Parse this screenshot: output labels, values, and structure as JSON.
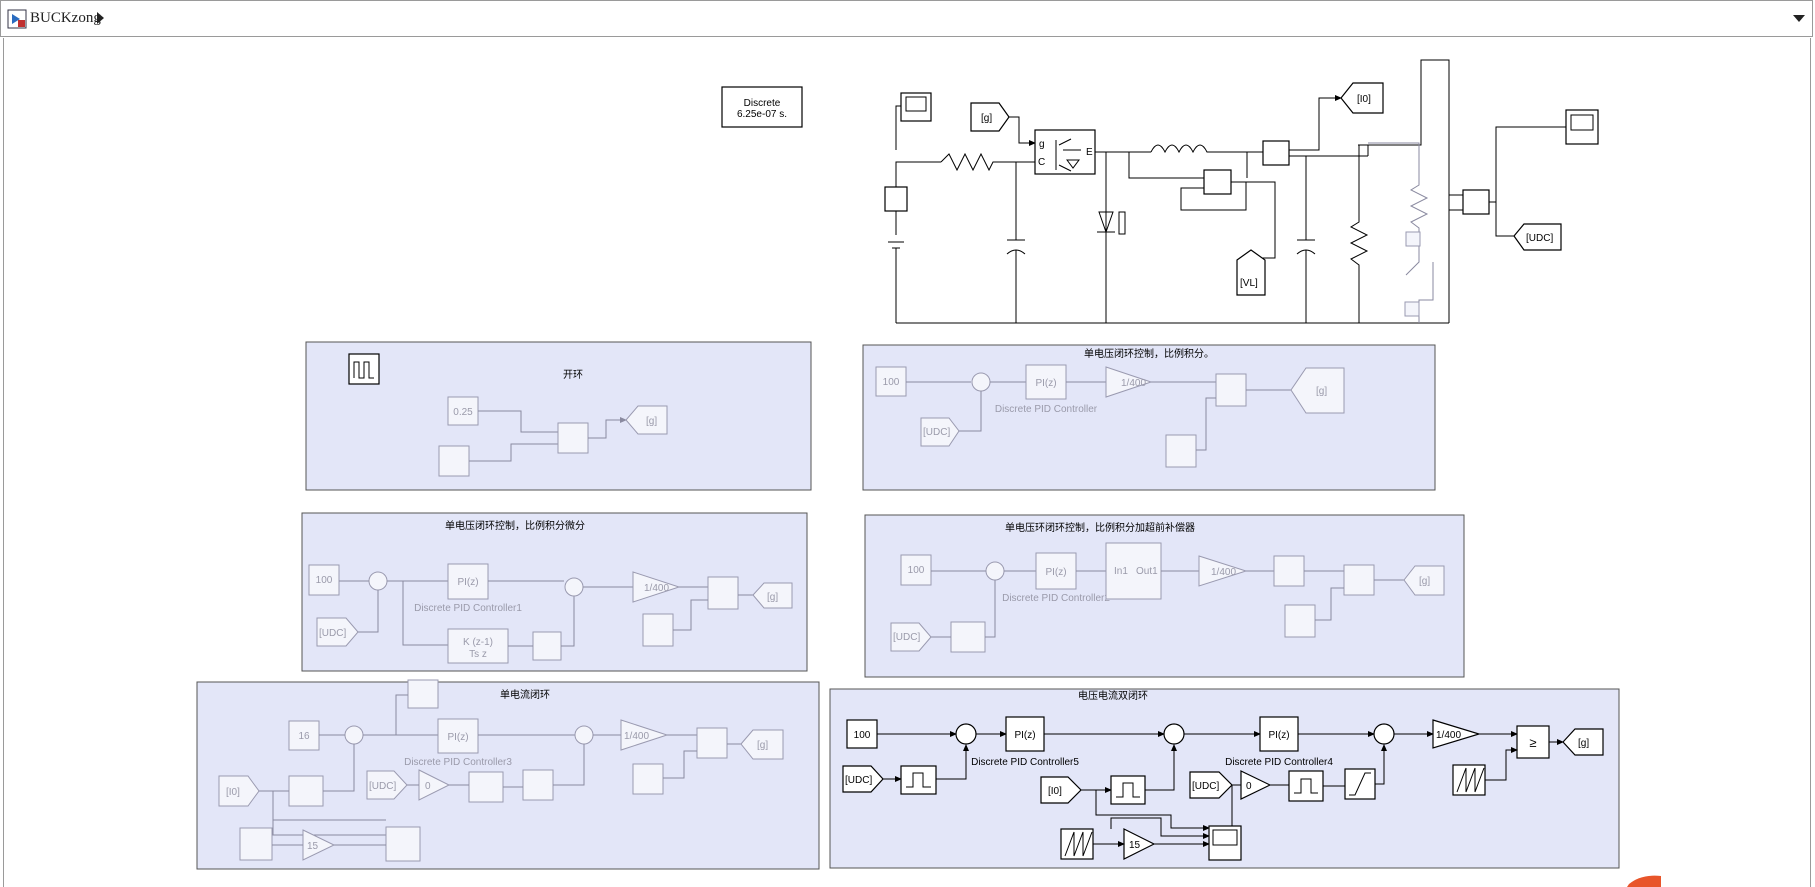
{
  "window": {
    "model_name": "BUCKzong"
  },
  "powergui": {
    "line1": "Discrete",
    "line2": "6.25e-07 s."
  },
  "circuit": {
    "goto_g": "[g]",
    "goto_i0": "[I0]",
    "goto_vl": "[VL]",
    "goto_udc": "[UDC]",
    "igbt_g": "g",
    "igbt_c": "C",
    "igbt_e": "E"
  },
  "areas": {
    "open_loop": {
      "title": "开环",
      "const": "0.25",
      "goto": "[g]"
    },
    "pi_voltage": {
      "title": "单电压闭环控制，比例积分。",
      "const": "100",
      "from_udc": "[UDC]",
      "pid": "PI(z)",
      "pid_name": "Discrete PID Controller",
      "gain": "1/400",
      "goto": "[g]"
    },
    "pid_voltage": {
      "title": "单电压闭环控制，比例积分微分",
      "const": "100",
      "from_udc": "[UDC]",
      "pid": "PI(z)",
      "pid_name": "Discrete PID Controller1",
      "tf_num": "K (z-1)",
      "tf_den": "Ts z",
      "gain": "1/400",
      "goto": "[g]"
    },
    "lead_voltage": {
      "title": "单电压环闭环控制，比例积分加超前补偿器",
      "const": "100",
      "from_udc": "[UDC]",
      "pid": "PI(z)",
      "pid_name": "Discrete PID Controller2",
      "sub_in": "In1",
      "sub_out": "Out1",
      "gain": "1/400",
      "goto": "[g]"
    },
    "current_loop": {
      "title": "单电流闭环",
      "const": "16",
      "from_i0": "[I0]",
      "from_udc": "[UDC]",
      "pid": "PI(z)",
      "pid_name": "Discrete PID Controller3",
      "zero": "0",
      "gain": "1/400",
      "goto": "[g]",
      "gain15": "15"
    },
    "dual_loop": {
      "title": "电压电流双闭环",
      "const": "100",
      "from_udc": "[UDC]",
      "pid5": "PI(z)",
      "pid5_name": "Discrete PID Controller5",
      "pid4": "PI(z)",
      "pid4_name": "Discrete PID Controller4",
      "from_i0": "[I0]",
      "from_udc2": "[UDC]",
      "zero": "0",
      "gain": "1/400",
      "relop": "≥",
      "goto": "[g]",
      "gain15": "15"
    }
  },
  "colors": {
    "area_fill": "#e3e6f8",
    "faded": "#9a9aaa"
  }
}
